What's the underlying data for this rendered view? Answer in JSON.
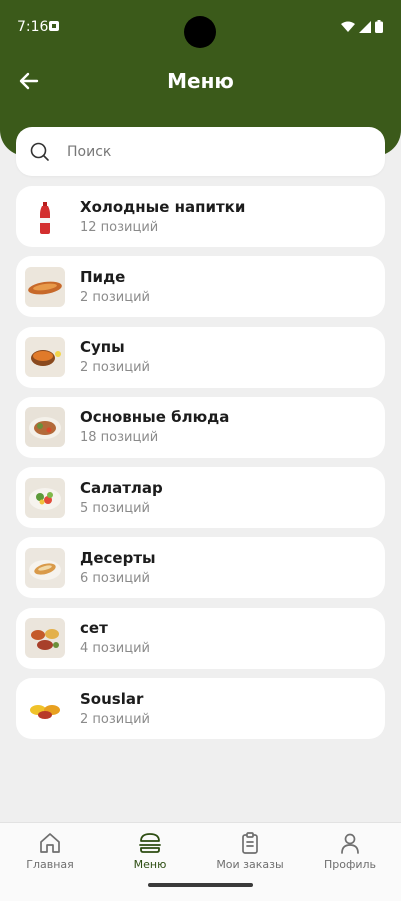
{
  "status_bar": {
    "time": "7:16"
  },
  "header": {
    "title": "Меню"
  },
  "search": {
    "placeholder": "Поиск"
  },
  "categories": [
    {
      "name": "Холодные напитки",
      "count": "12 позиций",
      "thumb": "cola-bottle"
    },
    {
      "name": "Пиде",
      "count": "2 позиций",
      "thumb": "pide"
    },
    {
      "name": "Супы",
      "count": "2 позиций",
      "thumb": "soup"
    },
    {
      "name": "Основные блюда",
      "count": "18 позиций",
      "thumb": "main-dish"
    },
    {
      "name": "Салатлар",
      "count": "5 позиций",
      "thumb": "salad"
    },
    {
      "name": "Десерты",
      "count": "6 позиций",
      "thumb": "dessert"
    },
    {
      "name": "сет",
      "count": "4 позиций",
      "thumb": "set"
    },
    {
      "name": "Souslar",
      "count": "2 позиций",
      "thumb": "sauces"
    }
  ],
  "tabbar": {
    "home": "Главная",
    "menu": "Меню",
    "orders": "Мои заказы",
    "profile": "Профиль"
  },
  "colors": {
    "brand": "#3b5a1a",
    "background": "#efefef",
    "active_tab": "#2d4d12"
  }
}
